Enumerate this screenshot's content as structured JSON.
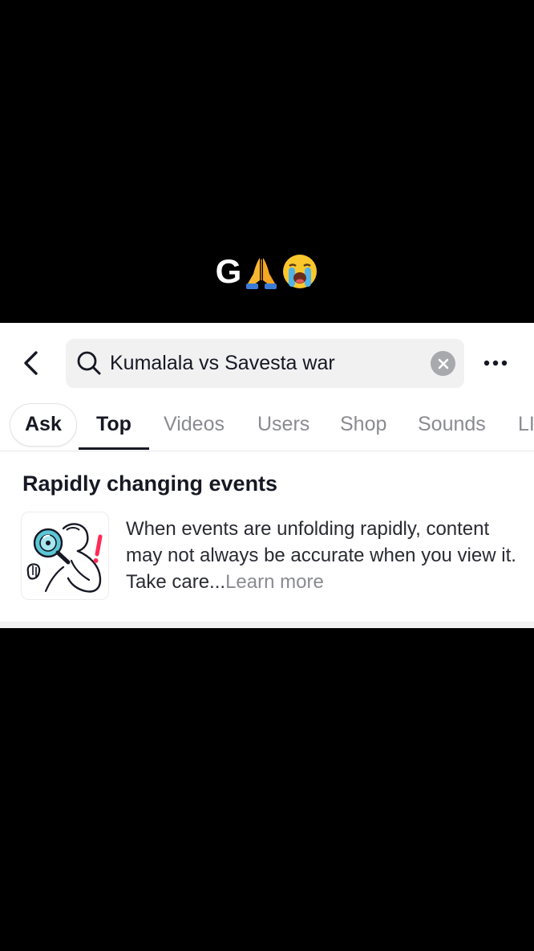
{
  "caption": {
    "text": "G",
    "emojis": [
      "folded-hands",
      "loudly-crying-face"
    ]
  },
  "search": {
    "query": "Kumalala vs Savesta war"
  },
  "tabs": [
    {
      "label": "Ask"
    },
    {
      "label": "Top"
    },
    {
      "label": "Videos"
    },
    {
      "label": "Users"
    },
    {
      "label": "Shop"
    },
    {
      "label": "Sounds"
    },
    {
      "label": "LI"
    }
  ],
  "active_tab": "Top",
  "notice": {
    "title": "Rapidly changing events",
    "body": "When events are unfolding rapidly, content may not always be accurate when you view it. Take care...",
    "link": "Learn more"
  },
  "icons": [
    "back-arrow-icon",
    "search-icon",
    "clear-icon",
    "more-options-icon",
    "magnifying-glass-person-illustration"
  ],
  "colors": {
    "text_primary": "#161823",
    "text_secondary": "#8a8b91",
    "search_bg": "#f1f1f2",
    "accent_red": "#fe2c55",
    "accent_teal": "#5bc7d6"
  }
}
